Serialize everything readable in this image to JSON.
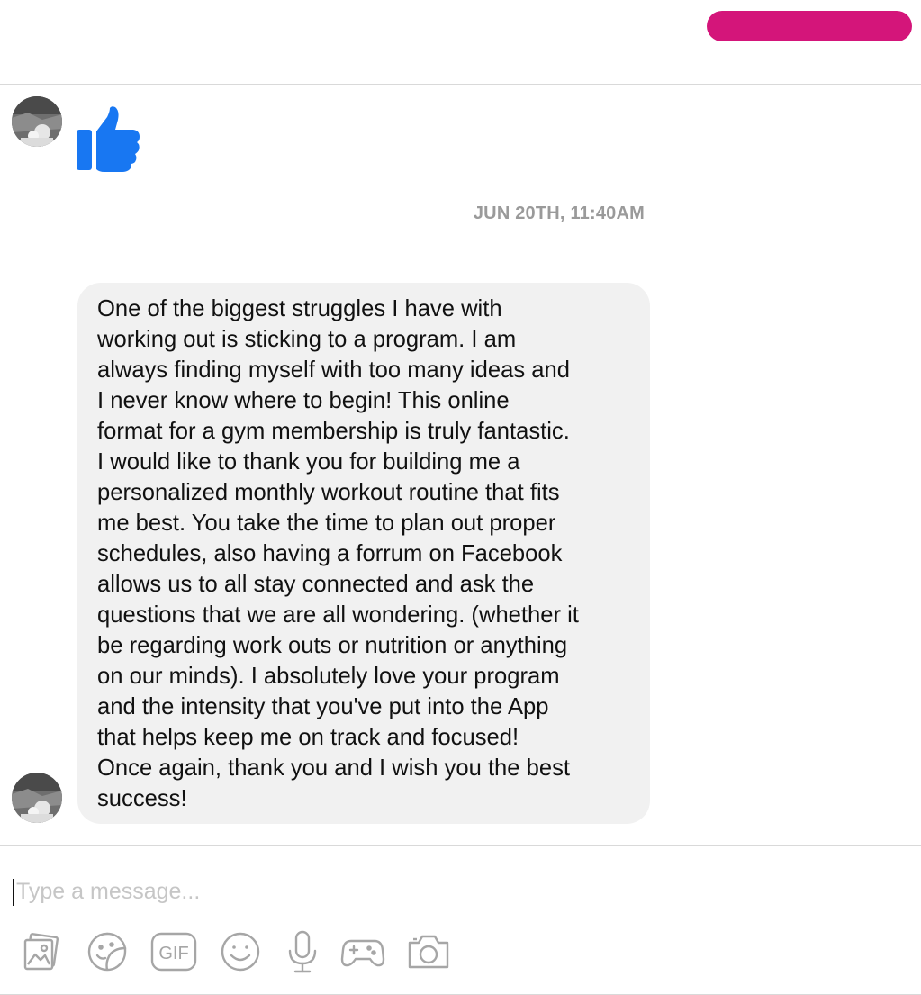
{
  "header": {
    "pill_color": "#d4157a"
  },
  "colors": {
    "accent_blue": "#1877f2",
    "bubble_bg": "#f1f1f1",
    "timestamp_gray": "#9a9a9a",
    "icon_gray": "#a6a6a6"
  },
  "conversation": {
    "reaction_icon": "thumbs-up-icon",
    "timestamp": "JUN 20TH, 11:40AM",
    "message": {
      "text": "One of the biggest struggles I have with\nworking out is sticking to a program. I am\nalways finding myself with too many ideas and\nI never know where to begin! This online\nformat for a gym membership is truly fantastic.\nI would like to  thank you for building me a\npersonalized monthly workout routine that fits\nme best. You take the time to plan out proper\nschedules, also having a forrum on Facebook\nallows us to all stay connected and ask the\nquestions that we are all wondering. (whether it\nbe regarding work outs or nutrition or anything\non our minds). I absolutely love your program\nand the intensity that you've put into the App\nthat helps keep me on track and focused!\nOnce again, thank you and I wish you the best\nsuccess!"
    }
  },
  "composer": {
    "placeholder": "Type a message...",
    "value": ""
  },
  "toolbar": {
    "items": [
      {
        "icon": "photo-icon"
      },
      {
        "icon": "sticker-icon"
      },
      {
        "icon": "gif-icon",
        "label": "GIF"
      },
      {
        "icon": "emoji-icon"
      },
      {
        "icon": "microphone-icon"
      },
      {
        "icon": "game-controller-icon"
      },
      {
        "icon": "camera-icon"
      }
    ]
  }
}
